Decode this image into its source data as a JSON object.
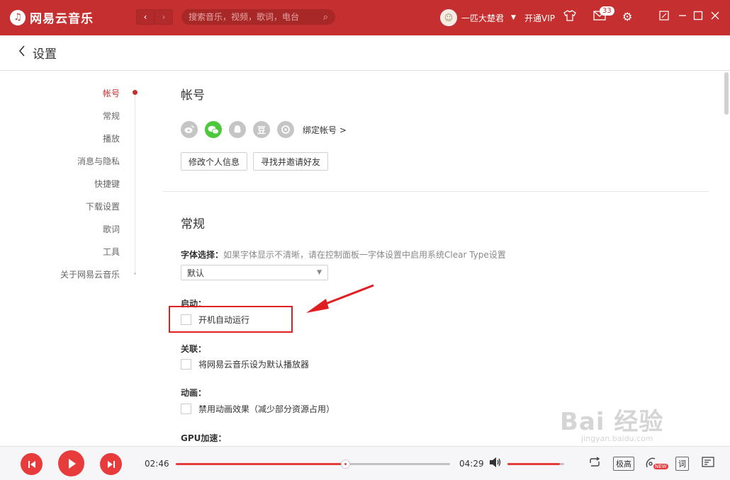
{
  "titlebar": {
    "app_name": "网易云音乐",
    "search_placeholder": "搜索音乐，视频，歌词，电台",
    "username": "一匹大楚君",
    "vip": "开通VIP",
    "mail_count": "33"
  },
  "header": {
    "title": "设置"
  },
  "sidenav": {
    "items": [
      {
        "label": "帐号"
      },
      {
        "label": "常规"
      },
      {
        "label": "播放"
      },
      {
        "label": "消息与隐私"
      },
      {
        "label": "快捷键"
      },
      {
        "label": "下载设置"
      },
      {
        "label": "歌词"
      },
      {
        "label": "工具"
      },
      {
        "label": "关于网易云音乐"
      }
    ],
    "active_index": 0
  },
  "account": {
    "title": "帐号",
    "share_icons": [
      "weibo-icon",
      "wechat-icon",
      "qq-icon",
      "douban-icon",
      "netease-icon"
    ],
    "douban_glyph": "豆",
    "bind_link": "绑定帐号 >",
    "edit_profile": "修改个人信息",
    "invite_friends": "寻找并邀请好友"
  },
  "general": {
    "title": "常规",
    "font_label": "字体选择：",
    "font_hint": "如果字体显示不清晰，请在控制面板一字体设置中启用系统Clear Type设置",
    "font_value": "默认",
    "startup_label": "启动：",
    "startup_option": "开机自动运行",
    "association_label": "关联：",
    "association_option": "将网易云音乐设为默认播放器",
    "animation_label": "动画：",
    "animation_option": "禁用动画效果（减少部分资源占用）",
    "gpu_label": "GPU加速："
  },
  "player": {
    "elapsed": "02:46",
    "total": "04:29",
    "progress_fraction": 0.617,
    "volume_fraction": 0.92,
    "quality": "极高",
    "lyric": "词",
    "new_badge": "NEW"
  },
  "watermark": {
    "main": "Bai 经验",
    "sub": "jingyan.baidu.com"
  },
  "colors": {
    "brand": "#c62f2f",
    "accent": "#e83c3c",
    "annotation": "#e02020"
  }
}
